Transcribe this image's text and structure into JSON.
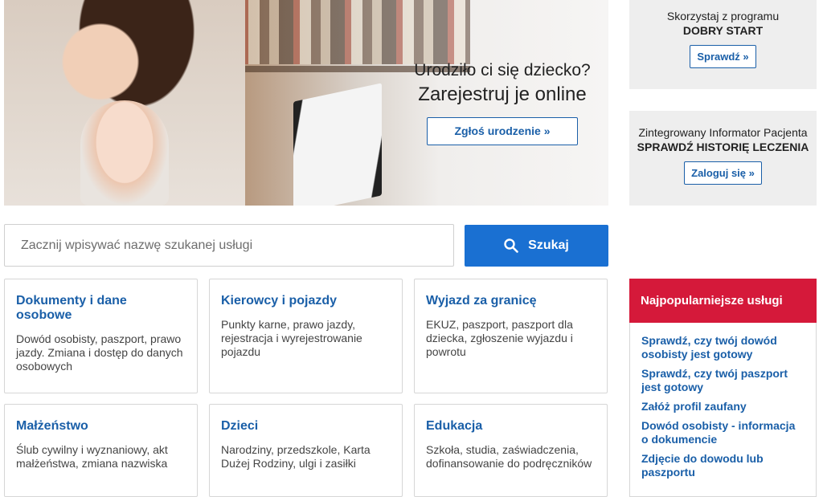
{
  "hero": {
    "question": "Urodziło ci się dziecko?",
    "headline": "Zarejestruj je online",
    "button_label": "Zgłoś urodzenie »"
  },
  "promos": [
    {
      "line1": "Skorzystaj z programu",
      "line2": "DOBRY START",
      "button_label": "Sprawdź »"
    },
    {
      "line1": "Zintegrowany Informator Pacjenta",
      "line2": "SPRAWDŹ HISTORIĘ LECZENIA",
      "button_label": "Zaloguj się »"
    }
  ],
  "search": {
    "placeholder": "Zacznij wpisywać nazwę szukanej usługi",
    "button_label": "Szukaj",
    "icon": "search-icon"
  },
  "categories": [
    {
      "title": "Dokumenty i dane osobowe",
      "desc": "Dowód osobisty, paszport, prawo jazdy. Zmiana i dostęp do danych osobowych"
    },
    {
      "title": "Kierowcy i pojazdy",
      "desc": "Punkty karne, prawo jazdy, rejestracja i wyrejestrowanie pojazdu"
    },
    {
      "title": "Wyjazd za granicę",
      "desc": "EKUZ, paszport, paszport dla dziecka, zgłoszenie wyjazdu i powrotu"
    },
    {
      "title": "Małżeństwo",
      "desc": "Ślub cywilny i wyznaniowy, akt małżeństwa, zmiana nazwiska"
    },
    {
      "title": "Dzieci",
      "desc": "Narodziny, przedszkole, Karta Dużej Rodziny, ulgi i zasiłki"
    },
    {
      "title": "Edukacja",
      "desc": "Szkoła, studia, zaświadczenia, dofinansowanie do podręczników"
    }
  ],
  "popular": {
    "title": "Najpopularniejsze usługi",
    "items": [
      "Sprawdź, czy twój dowód osobisty jest gotowy",
      "Sprawdź, czy twój paszport jest gotowy",
      "Załóż profil zaufany",
      "Dowód osobisty - informacja o dokumencie",
      "Zdjęcie do dowodu lub paszportu"
    ]
  },
  "colors": {
    "link_blue": "#1a5fa8",
    "search_button_blue": "#1a70d2",
    "popular_red": "#d5193a",
    "promo_gray": "#eeeeee"
  }
}
